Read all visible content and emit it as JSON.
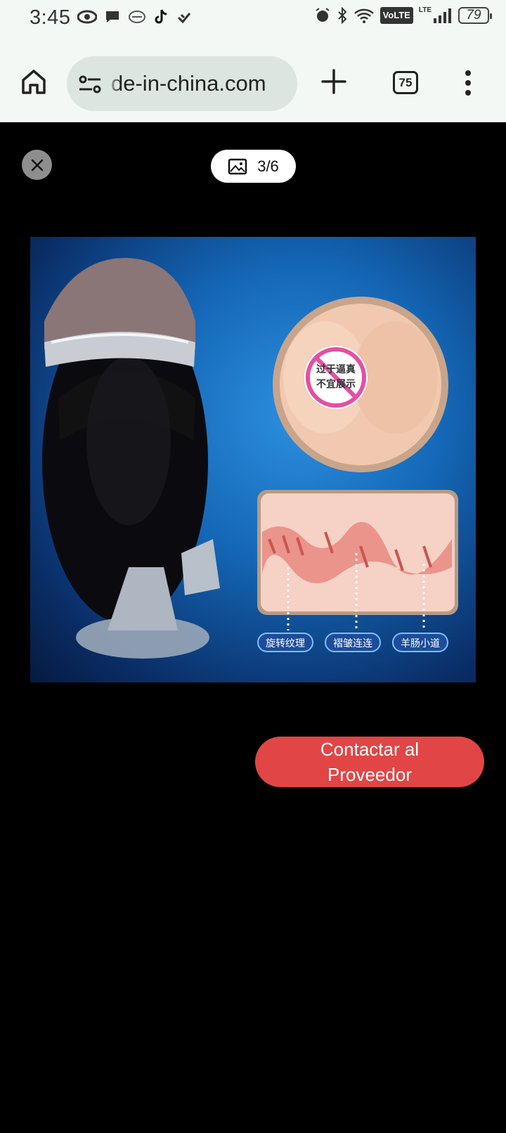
{
  "status_bar": {
    "time": "3:45",
    "network_badge": "VoLTE",
    "lte_label": "LTE",
    "battery_level": "79",
    "icons": [
      "eye-icon",
      "chat-bubble-icon",
      "handshake-icon",
      "tiktok-icon",
      "heart-check-icon",
      "alarm-icon",
      "bluetooth-icon",
      "wifi-icon",
      "signal-icon",
      "battery-icon"
    ]
  },
  "browser": {
    "url_visible": "de-in-china.com",
    "tab_count": "75",
    "icons": [
      "home-icon",
      "site-info-icon",
      "plus-icon",
      "tabs-icon",
      "more-vert-icon"
    ]
  },
  "viewer": {
    "counter": "3/6",
    "icons": [
      "close-icon",
      "image-icon"
    ],
    "photo": {
      "badge_text_line1": "过于逼真",
      "badge_text_line2": "不宜展示",
      "labels": [
        "旋转纹理",
        "褶皱连连",
        "羊肠小道"
      ]
    }
  },
  "cta": {
    "contact_label": "Contactar al Proveedor"
  },
  "colors": {
    "chrome_bg": "#f3f8f5",
    "url_pill_bg": "#dde5e1",
    "viewer_bg": "#000000",
    "cta_bg": "#e24545",
    "photo_blue": "#1466b5"
  }
}
